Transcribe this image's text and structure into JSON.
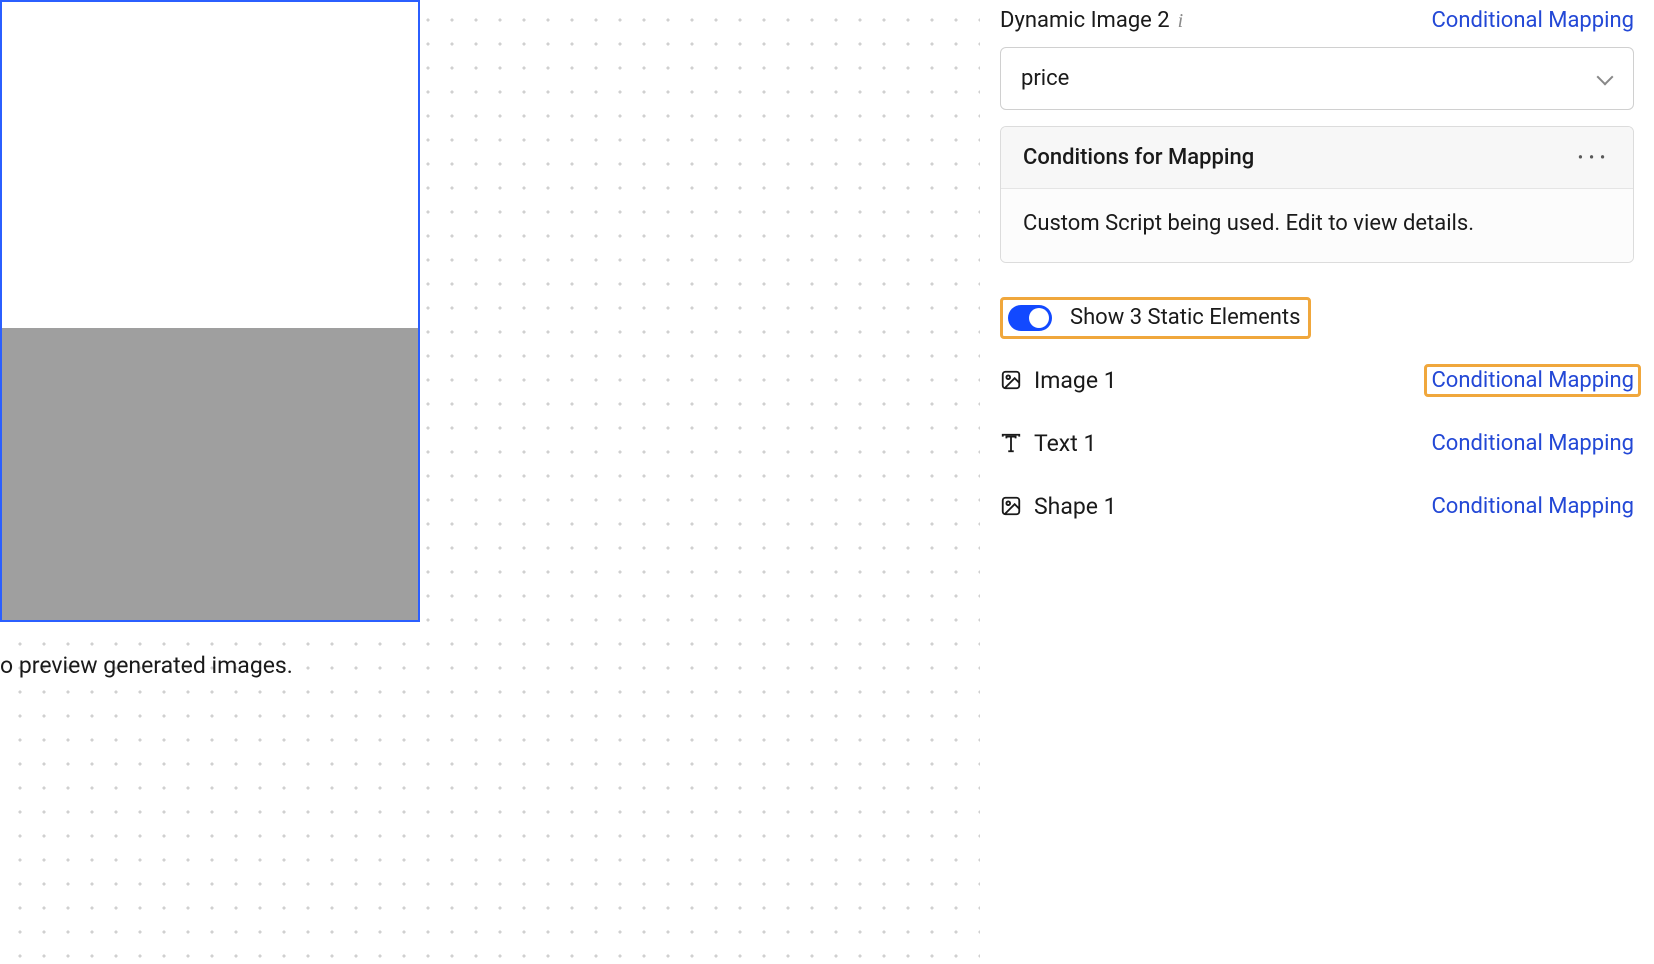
{
  "canvas": {
    "preview_text": "o preview generated images."
  },
  "panel": {
    "dynamic_image": {
      "title": "Dynamic Image 2",
      "link": "Conditional Mapping",
      "dropdown_value": "price"
    },
    "conditions": {
      "title": "Conditions for Mapping",
      "body": "Custom Script being used. Edit to view details."
    },
    "toggle": {
      "label": "Show 3 Static Elements"
    },
    "elements": [
      {
        "label": "Image 1",
        "link": "Conditional Mapping",
        "highlighted": true
      },
      {
        "label": "Text 1",
        "link": "Conditional Mapping",
        "highlighted": false
      },
      {
        "label": "Shape 1",
        "link": "Conditional Mapping",
        "highlighted": false
      }
    ]
  }
}
